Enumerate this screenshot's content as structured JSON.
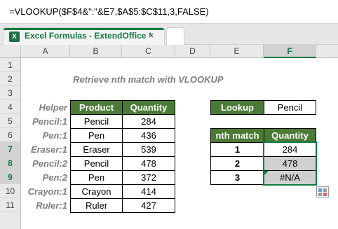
{
  "formula_bar": {
    "formula": "=VLOOKUP($F$4&\":\"&E7,$A$5:$C$11,3,FALSE)"
  },
  "tabs": [
    {
      "title": "Excel Formulas - ExtendOffice *",
      "close": "×",
      "icon": "X"
    }
  ],
  "columns": [
    "A",
    "B",
    "C",
    "D",
    "E",
    "F"
  ],
  "rows": [
    "1",
    "2",
    "3",
    "4",
    "5",
    "6",
    "7",
    "8",
    "9",
    "10",
    "11"
  ],
  "sheet": {
    "title": "Retrieve nth match with VLOOKUP",
    "table_headers": {
      "helper": "Helper",
      "product": "Product",
      "quantity": "Quantity"
    },
    "table_rows": [
      {
        "helper": "Pencil:1",
        "product": "Pencil",
        "quantity": "284"
      },
      {
        "helper": "Pen:1",
        "product": "Pen",
        "quantity": "436"
      },
      {
        "helper": "Eraser:1",
        "product": "Eraser",
        "quantity": "539"
      },
      {
        "helper": "Pencil:2",
        "product": "Pencil",
        "quantity": "478"
      },
      {
        "helper": "Pen:2",
        "product": "Pen",
        "quantity": "372"
      },
      {
        "helper": "Crayon:1",
        "product": "Crayon",
        "quantity": "414"
      },
      {
        "helper": "Ruler:1",
        "product": "Ruler",
        "quantity": "427"
      }
    ],
    "lookup": {
      "label": "Lookup",
      "value": "Pencil"
    },
    "result_headers": {
      "nth": "nth match",
      "quantity": "Quantity"
    },
    "result_rows": [
      {
        "nth": "1",
        "quantity": "284"
      },
      {
        "nth": "2",
        "quantity": "478"
      },
      {
        "nth": "3",
        "quantity": "#N/A"
      }
    ]
  },
  "colors": {
    "header_green": "#4b7a36",
    "accent": "#107c41",
    "selection_gray": "#d0d0d0"
  }
}
